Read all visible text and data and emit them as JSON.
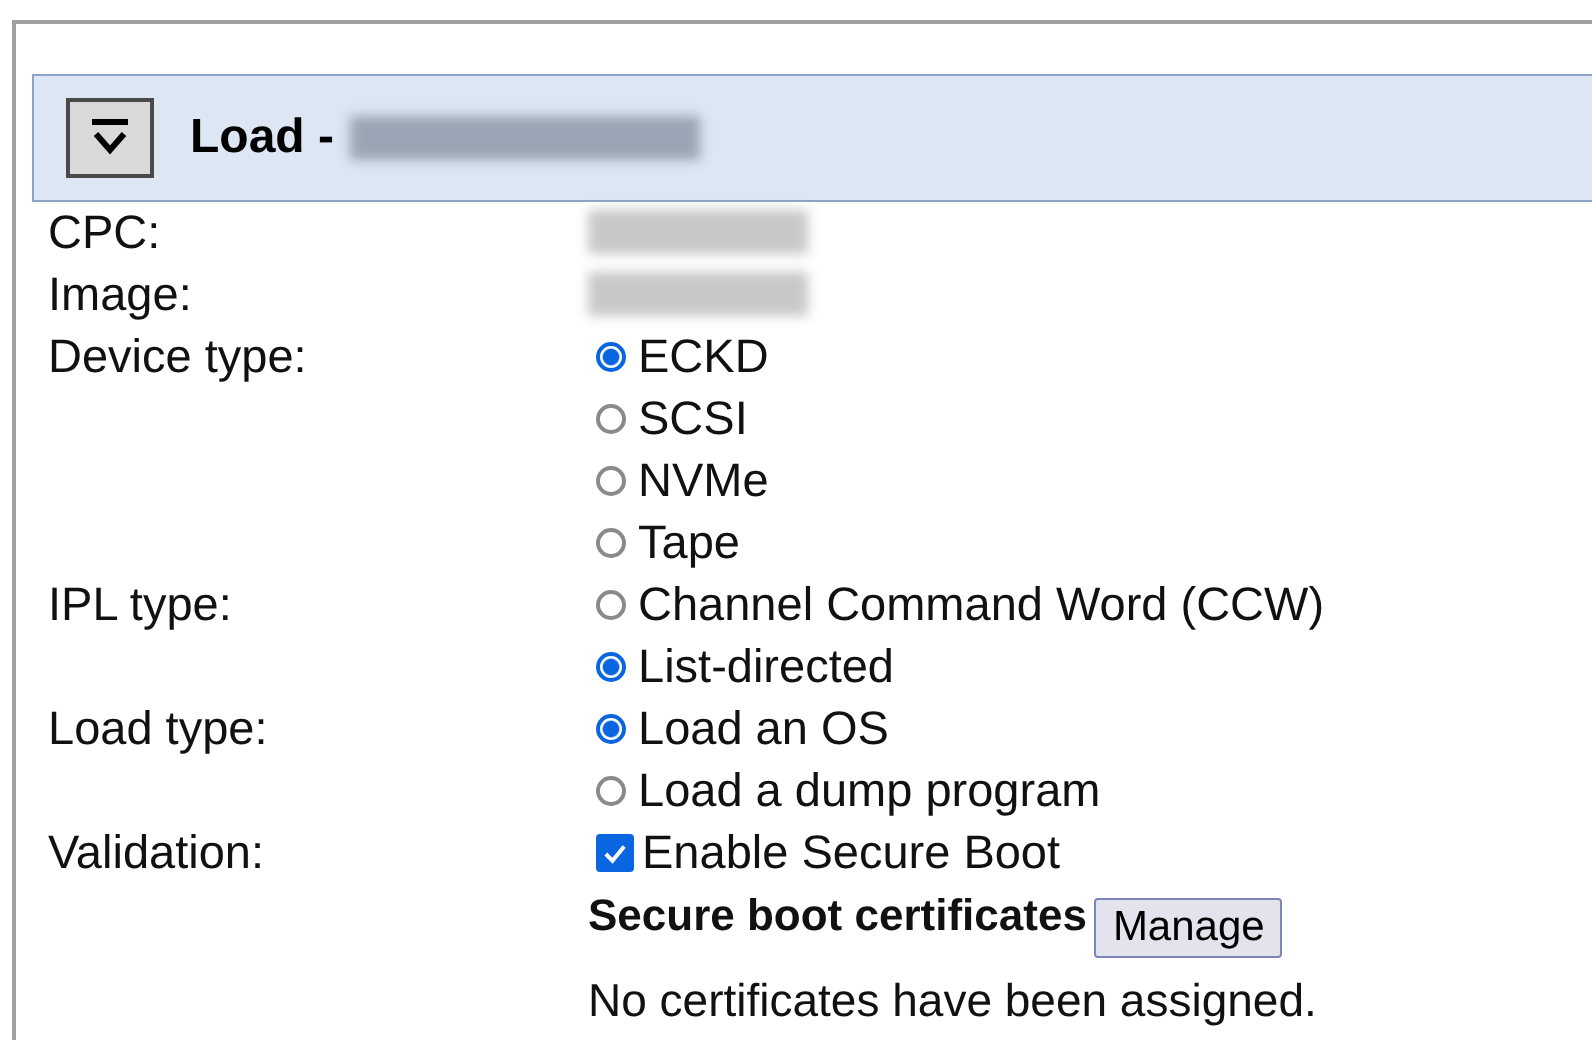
{
  "panel": {
    "title": "Load -",
    "expanded": true
  },
  "fields": [
    {
      "kind": "redacted",
      "label": "CPC:"
    },
    {
      "kind": "redacted",
      "label": "Image:"
    },
    {
      "kind": "radio",
      "label": "Device type:",
      "options": [
        {
          "label": "ECKD",
          "selected": true
        },
        {
          "label": "SCSI",
          "selected": false
        },
        {
          "label": "NVMe",
          "selected": false
        },
        {
          "label": "Tape",
          "selected": false
        }
      ]
    },
    {
      "kind": "radio",
      "label": "IPL type:",
      "options": [
        {
          "label": "Channel Command Word (CCW)",
          "selected": false
        },
        {
          "label": "List-directed",
          "selected": true
        }
      ]
    },
    {
      "kind": "radio",
      "label": "Load type:",
      "options": [
        {
          "label": "Load an OS",
          "selected": true
        },
        {
          "label": "Load a dump program",
          "selected": false
        }
      ]
    },
    {
      "kind": "checkbox",
      "label": "Validation:",
      "option": {
        "label": "Enable Secure Boot",
        "checked": true
      }
    }
  ],
  "certificates": {
    "heading": "Secure boot certificates",
    "button": "Manage",
    "message": "No certificates have been assigned."
  }
}
